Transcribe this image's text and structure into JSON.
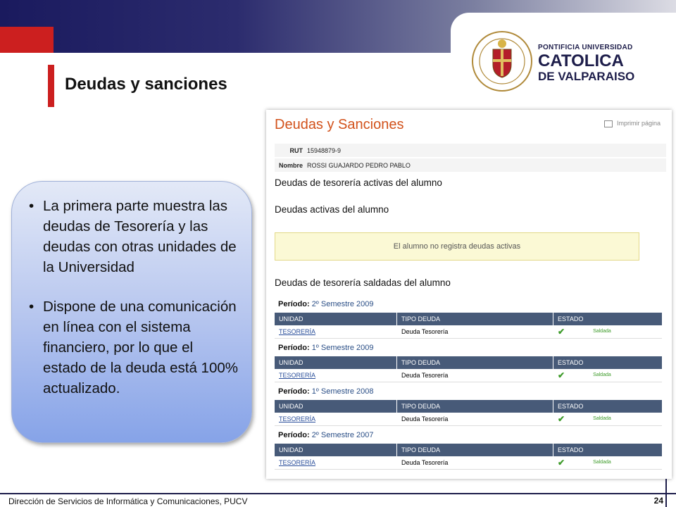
{
  "slide": {
    "title": "Deudas y sanciones",
    "footer": "Dirección de Servicios de Informática y Comunicaciones, PUCV",
    "page_number": "24"
  },
  "university": {
    "line1": "PONTIFICIA UNIVERSIDAD",
    "line2": "CATOLICA",
    "line3": "DE VALPARAISO"
  },
  "callout": {
    "bullets": [
      "La primera parte muestra las deudas de Tesorería y las deudas con otras unidades de la Universidad",
      "Dispone de una comunicación en línea con el sistema financiero, por lo que el estado de la deuda está 100% actualizado."
    ]
  },
  "screenshot": {
    "title": "Deudas y Sanciones",
    "print_label": "Imprimir página",
    "rut_label": "RUT",
    "rut_value": "15948879-9",
    "nombre_label": "Nombre",
    "nombre_value": "ROSSI GUAJARDO PEDRO PABLO",
    "section1": "Deudas de tesorería activas del alumno",
    "section2": "Deudas activas del alumno",
    "alert": "El alumno no registra deudas activas",
    "section3": "Deudas de tesorería saldadas del alumno",
    "period_label": "Período:",
    "headers": [
      "UNIDAD",
      "TIPO DEUDA",
      "ESTADO"
    ],
    "periods": [
      {
        "period": "2º Semestre 2009",
        "unidad": "TESORERÍA",
        "tipo": "Deuda Tesorería",
        "estado": "Saldada"
      },
      {
        "period": "1º Semestre 2009",
        "unidad": "TESORERÍA",
        "tipo": "Deuda Tesorería",
        "estado": "Saldada"
      },
      {
        "period": "1º Semestre 2008",
        "unidad": "TESORERÍA",
        "tipo": "Deuda Tesorería",
        "estado": "Saldada"
      },
      {
        "period": "2º Semestre 2007",
        "unidad": "TESORERÍA",
        "tipo": "Deuda Tesorería",
        "estado": "Saldada"
      }
    ],
    "check_icon": "check-icon"
  }
}
